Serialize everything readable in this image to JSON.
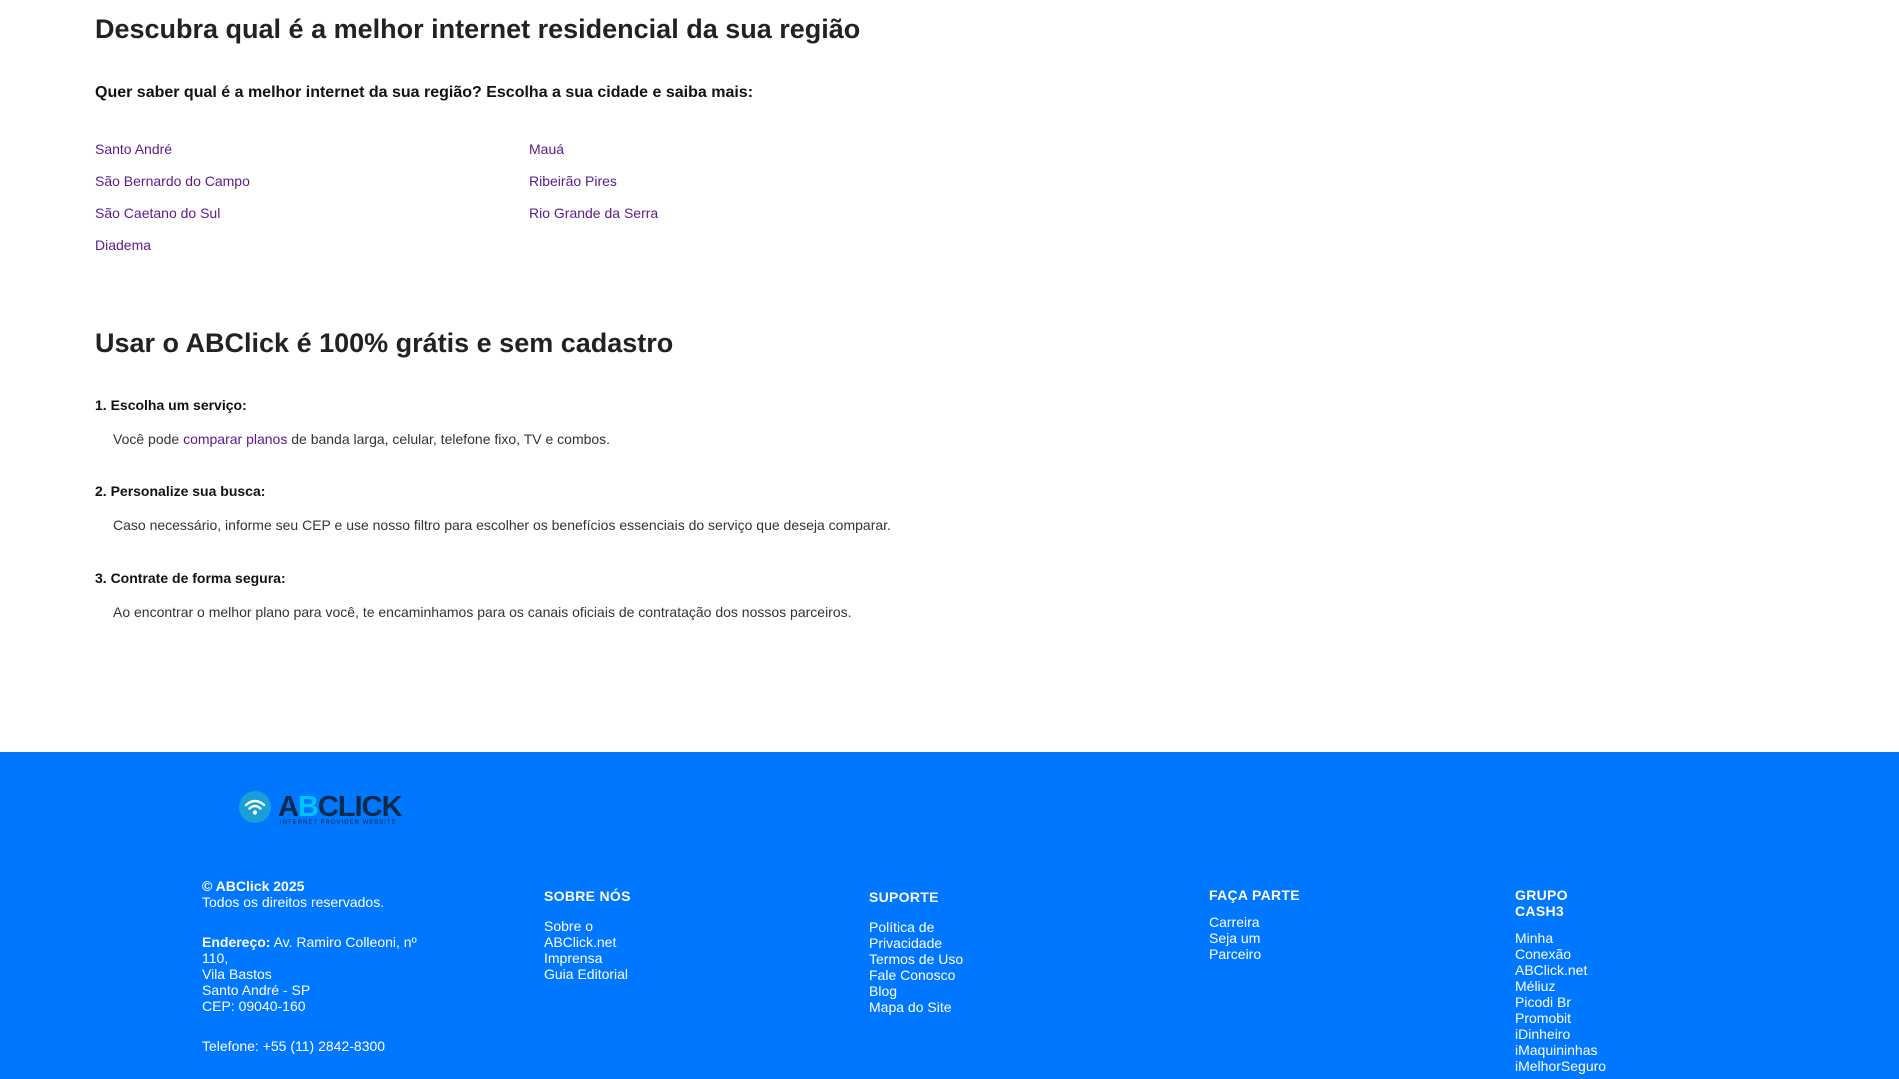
{
  "regions": {
    "title": "Descubra qual é a melhor internet residencial da sua região",
    "subtitle": "Quer saber qual é a melhor internet da sua região? Escolha a sua cidade e saiba mais:",
    "cities_col1": [
      "Santo André",
      "São Bernardo do Campo",
      "São Caetano do Sul",
      "Diadema"
    ],
    "cities_col2": [
      "Mauá",
      "Ribeirão Pires",
      "Rio Grande da Serra"
    ]
  },
  "howto": {
    "title": "Usar o ABClick é 100% grátis e sem cadastro",
    "steps": [
      {
        "title": "1. Escolha um serviço:",
        "text_before": "Você pode ",
        "link": "comparar planos",
        "text_after": " de banda larga, celular, telefone fixo, TV e combos."
      },
      {
        "title": "2. Personalize sua busca:",
        "text": "Caso necessário, informe seu CEP e use nosso filtro para escolher os benefícios essenciais do serviço que deseja comparar."
      },
      {
        "title": "3. Contrate de forma segura:",
        "text": "Ao encontrar o melhor plano para você, te encaminhamos para os canais oficiais de contratação dos nossos parceiros."
      }
    ]
  },
  "footer": {
    "bg_color": "#0077ff",
    "logo": {
      "text_a": "A",
      "text_b": "B",
      "text_rest": "CLICK",
      "tagline": "INTERNET PROVIDER WEBSITE"
    },
    "copyright": "© ABClick 2025",
    "rights": "Todos os direitos reservados.",
    "address_label": "Endereço:",
    "address_line1": " Av. Ramiro Colleoni, nº",
    "address_line2": "110,",
    "address_line3": "Vila Bastos",
    "address_line4": "Santo André - SP",
    "address_line5": "CEP: 09040-160",
    "phone": "Telefone: +55 (11) 2842-8300",
    "sobre": {
      "heading": "SOBRE NÓS",
      "links": [
        "Sobre o",
        "ABClick.net",
        "Imprensa",
        "Guia Editorial"
      ]
    },
    "suporte": {
      "heading": "SUPORTE",
      "links": [
        "Política de",
        "Privacidade",
        "Termos de Uso",
        "Fale Conosco",
        "Blog",
        "Mapa do Site"
      ]
    },
    "faca": {
      "heading": "FAÇA PARTE",
      "links": [
        "Carreira",
        "Seja um",
        "Parceiro"
      ]
    },
    "grupo": {
      "heading1": "GRUPO",
      "heading2": "CASH3",
      "links": [
        "Minha",
        "Conexão",
        "ABClick.net",
        "Méliuz",
        "Picodi Br",
        "Promobit",
        "iDinheiro",
        "iMaquininhas",
        "iMelhorSeguro"
      ]
    }
  }
}
